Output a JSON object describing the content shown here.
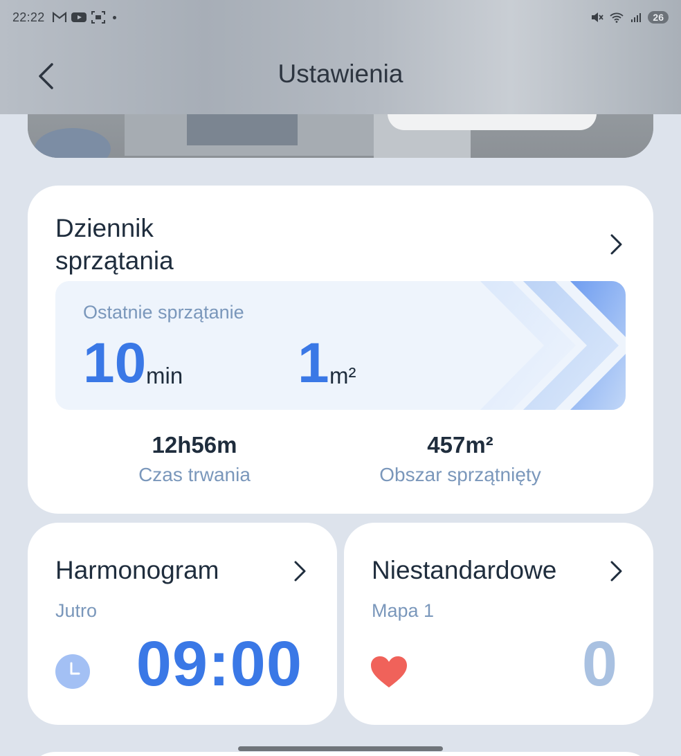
{
  "status_bar": {
    "time": "22:22",
    "battery": "26",
    "left_icons": [
      "gmail-icon",
      "youtube-icon",
      "screenshot-icon"
    ],
    "right_icons": [
      "mute-icon",
      "wifi-icon",
      "signal-icon"
    ]
  },
  "header": {
    "title": "Ustawienia",
    "back_icon": "chevron-left-icon"
  },
  "cleaning_log": {
    "title": "Dziennik sprzątania",
    "last_cleaning_label": "Ostatnie sprzątanie",
    "last_duration_value": "10",
    "last_duration_unit": "min",
    "last_area_value": "1",
    "last_area_unit": "m²",
    "total_duration_value": "12h56m",
    "total_duration_label": "Czas trwania",
    "total_area_value": "457m²",
    "total_area_label": "Obszar sprzątnięty"
  },
  "schedule": {
    "title": "Harmonogram",
    "day": "Jutro",
    "time": "09:00",
    "icon": "clock-icon"
  },
  "custom": {
    "title": "Niestandardowe",
    "map": "Mapa 1",
    "count": "0",
    "icon": "heart-icon"
  },
  "colors": {
    "accent": "#3a78e6",
    "muted_accent": "#a9c1e1",
    "label": "#7a97bb",
    "background": "#dde3ec",
    "heart": "#f0625a"
  }
}
